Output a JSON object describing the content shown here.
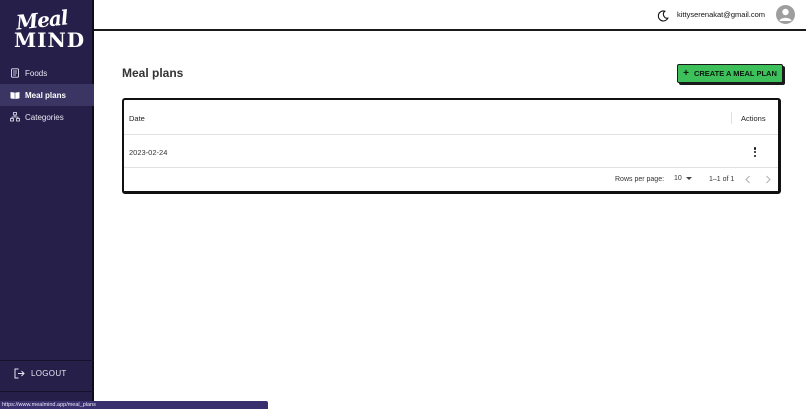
{
  "app": {
    "logo_line1": "Meal",
    "logo_line2": "MIND"
  },
  "sidebar": {
    "items": [
      {
        "label": "Foods",
        "icon": "document-icon",
        "active": false
      },
      {
        "label": "Meal plans",
        "icon": "book-icon",
        "active": true
      },
      {
        "label": "Categories",
        "icon": "hierarchy-icon",
        "active": false
      }
    ],
    "logout_label": "LOGOUT"
  },
  "header": {
    "user_email": "kittyserenakat@gmail.com",
    "theme_icon": "moon-icon",
    "avatar_icon": "user-avatar-icon"
  },
  "main": {
    "title": "Meal plans",
    "create_button": {
      "label": "CREATE A MEAL PLAN",
      "icon": "plus-icon",
      "color": "#3dbf5a"
    }
  },
  "table": {
    "columns": [
      "Date",
      "Actions"
    ],
    "rows": [
      {
        "date": "2023-02-24"
      }
    ],
    "pagination": {
      "rows_per_page_label": "Rows per page:",
      "rows_per_page_value": "10",
      "range": "1–1 of 1"
    }
  },
  "statusbar": {
    "url": "https://www.mealmind.app/meal_plans"
  },
  "colors": {
    "sidebar_bg": "#261f4a",
    "sidebar_active": "#3b3563",
    "accent_green": "#3dbf5a"
  }
}
